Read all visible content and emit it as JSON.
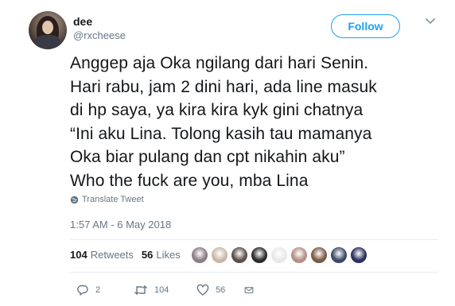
{
  "user": {
    "display_name": "dee",
    "handle": "@rxcheese"
  },
  "follow_label": "Follow",
  "tweet_lines": [
    "Anggep aja Oka ngilang dari hari Senin.",
    "Hari rabu, jam 2 dini hari, ada line masuk",
    "di hp saya, ya kira kira kyk gini chatnya",
    "“Ini aku Lina. Tolong kasih tau mamanya",
    "Oka biar pulang dan cpt nikahin aku”",
    "Who the fuck are you, mba Lina"
  ],
  "translate_label": "Translate Tweet",
  "timestamp": "1:57 AM - 6 May 2018",
  "stats": {
    "retweets_count": "104",
    "retweets_label": "Retweets",
    "likes_count": "56",
    "likes_label": "Likes"
  },
  "likers_colors": [
    "#8a7d86",
    "#c9b8a8",
    "#5d4e4a",
    "#2d2a2e",
    "#e8e8e8",
    "#b48f86",
    "#7a5a44",
    "#3b4a63",
    "#2a2f5a"
  ],
  "actions": {
    "reply_count": "2",
    "retweet_count": "104",
    "like_count": "56"
  },
  "colors": {
    "accent": "#1da1f2",
    "muted": "#657786",
    "text": "#14171a"
  }
}
